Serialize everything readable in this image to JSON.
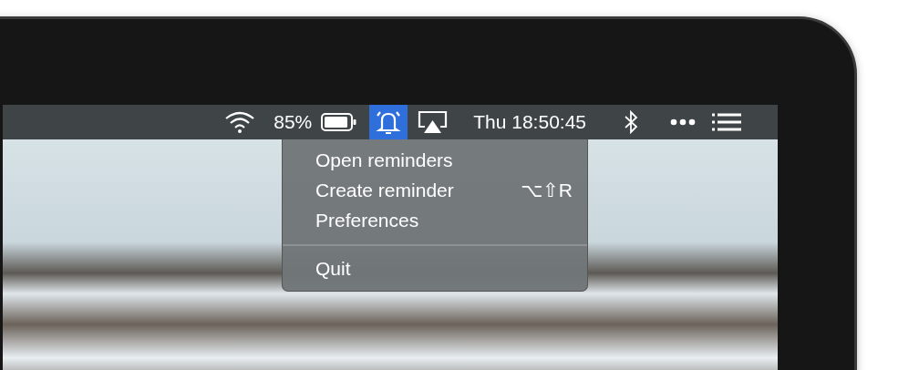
{
  "menu_bar": {
    "battery_percent": "85%",
    "clock": "Thu 18:50:45",
    "reminders_icon": {
      "selected": true
    }
  },
  "dropdown": {
    "open": true,
    "items": [
      {
        "kind": "item",
        "label": "Open reminders"
      },
      {
        "kind": "item",
        "label": "Create reminder",
        "shortcut": "⌥⇧R"
      },
      {
        "kind": "item",
        "label": "Preferences"
      },
      {
        "kind": "separator"
      },
      {
        "kind": "item",
        "label": "Quit"
      }
    ]
  }
}
